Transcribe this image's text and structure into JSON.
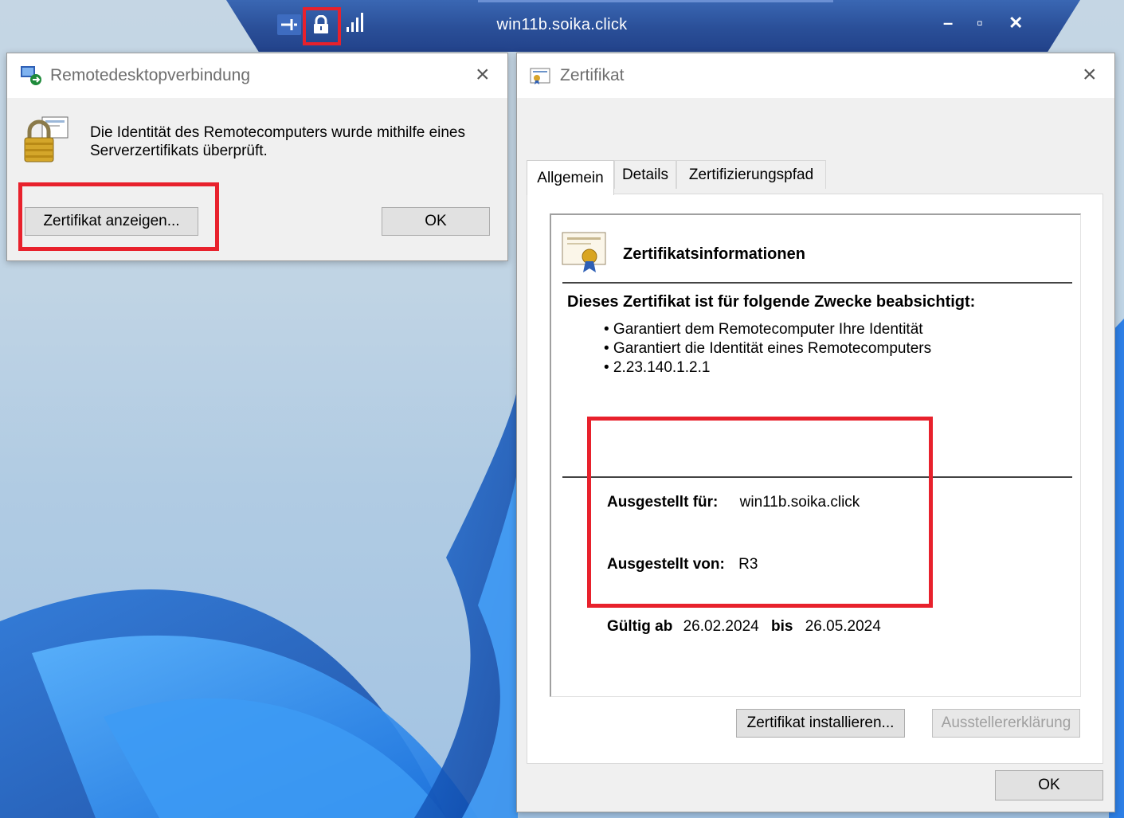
{
  "rdp_bar": {
    "title": "win11b.soika.click",
    "icons": [
      "pin-icon",
      "lock-icon",
      "signal-icon"
    ],
    "minimize": "–",
    "restore": "▫",
    "close": "✕"
  },
  "remote_dialog": {
    "title": "Remotedesktopverbindung",
    "message": "Die Identität des Remotecomputers wurde mithilfe eines Serverzertifikats überprüft.",
    "view_cert_button": "Zertifikat anzeigen...",
    "ok_button": "OK"
  },
  "cert_dialog": {
    "title": "Zertifikat",
    "tabs": [
      "Allgemein",
      "Details",
      "Zertifizierungspfad"
    ],
    "info_heading": "Zertifikatsinformationen",
    "purpose_heading": "Dieses Zertifikat ist für folgende Zwecke beabsichtigt:",
    "purposes": [
      "• Garantiert dem Remotecomputer Ihre Identität",
      "• Garantiert die Identität eines Remotecomputers",
      "• 2.23.140.1.2.1"
    ],
    "issued_to_label": "Ausgestellt für:",
    "issued_to_value": "win11b.soika.click",
    "issued_by_label": "Ausgestellt von:",
    "issued_by_value": "R3",
    "valid_from_label": "Gültig ab",
    "valid_from_value": "26.02.2024",
    "valid_to_label": "bis",
    "valid_to_value": "26.05.2024",
    "install_button": "Zertifikat installieren...",
    "issuer_statement_button": "Ausstellererklärung",
    "ok_button": "OK"
  },
  "colors": {
    "highlight": "#e8212c",
    "conn_bar": "#2a4f98",
    "wallpaper": "#b0cbe3"
  }
}
